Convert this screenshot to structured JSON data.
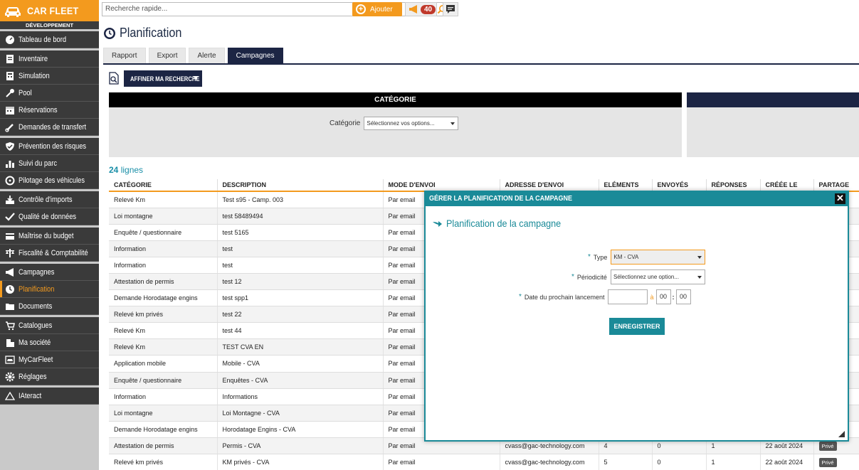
{
  "app": {
    "brand": "CAR FLEET",
    "environment": "DÉVELOPPEMENT"
  },
  "sidebar": {
    "groups": [
      [
        {
          "label": "Tableau de bord",
          "icon": "dashboard-icon"
        }
      ],
      [
        {
          "label": "Inventaire",
          "icon": "inventory-icon"
        },
        {
          "label": "Simulation",
          "icon": "calculator-icon"
        },
        {
          "label": "Pool",
          "icon": "key-icon"
        },
        {
          "label": "Réservations",
          "icon": "calendar-icon"
        },
        {
          "label": "Demandes de transfert",
          "icon": "link-icon"
        }
      ],
      [
        {
          "label": "Prévention des risques",
          "icon": "shield-icon"
        },
        {
          "label": "Suivi du parc",
          "icon": "bar-chart-icon"
        },
        {
          "label": "Pilotage des véhicules",
          "icon": "steering-wheel-icon"
        }
      ],
      [
        {
          "label": "Contrôle d'imports",
          "icon": "import-icon"
        },
        {
          "label": "Qualité de données",
          "icon": "check-icon"
        }
      ],
      [
        {
          "label": "Maîtrise du budget",
          "icon": "budget-icon"
        },
        {
          "label": "Fiscalité & Comptabilité",
          "icon": "balance-icon"
        }
      ],
      [
        {
          "label": "Campagnes",
          "icon": "megaphone-icon"
        },
        {
          "label": "Planification",
          "icon": "clock-icon",
          "active": true
        },
        {
          "label": "Documents",
          "icon": "folder-icon"
        }
      ],
      [
        {
          "label": "Catalogues",
          "icon": "cart-icon"
        },
        {
          "label": "Ma société",
          "icon": "building-icon"
        },
        {
          "label": "MyCarFleet",
          "icon": "car-icon"
        },
        {
          "label": "Réglages",
          "icon": "gear-icon"
        }
      ],
      [
        {
          "label": "IAteract",
          "icon": "ai-icon"
        }
      ]
    ]
  },
  "topbar": {
    "search_placeholder": "Recherche rapide...",
    "add_label": "Ajouter",
    "notif_count": "40"
  },
  "page": {
    "title": "Planification"
  },
  "tabs": [
    {
      "label": "Rapport"
    },
    {
      "label": "Export"
    },
    {
      "label": "Alerte"
    },
    {
      "label": "Campagnes",
      "active": true
    }
  ],
  "filters": {
    "button": "AFFINER MA RECHERCHE",
    "category_header": "CATÉGORIE",
    "category_label": "Catégorie",
    "category_placeholder": "Sélectionnez vos options..."
  },
  "table": {
    "count": "24",
    "count_suffix": " lignes",
    "columns": [
      "CATÉGORIE",
      "DESCRIPTION",
      "MODE D'ENVOI",
      "ADRESSE D'ENVOI",
      "ELÉMENTS",
      "ENVOYÉS",
      "RÉPONSES",
      "CRÉÉE LE",
      "PARTAGE"
    ],
    "rows": [
      [
        "Relevé Km",
        "Test s95 - Camp. 003",
        "Par email",
        "",
        "",
        "",
        "",
        "",
        ""
      ],
      [
        "Loi montagne",
        "test 58489494",
        "Par email",
        "",
        "",
        "",
        "",
        "",
        ""
      ],
      [
        "Enquête / questionnaire",
        "test 5165",
        "Par email",
        "",
        "",
        "",
        "",
        "",
        ""
      ],
      [
        "Information",
        "test",
        "Par email",
        "",
        "",
        "",
        "",
        "",
        ""
      ],
      [
        "Information",
        "test",
        "Par email",
        "",
        "",
        "",
        "",
        "",
        ""
      ],
      [
        "Attestation de permis",
        "test 12",
        "Par email",
        "",
        "",
        "",
        "",
        "",
        ""
      ],
      [
        "Demande Horodatage engins",
        "test spp1",
        "Par email",
        "",
        "",
        "",
        "",
        "",
        ""
      ],
      [
        "Relevé km privés",
        "test 22",
        "Par email",
        "",
        "",
        "",
        "",
        "",
        ""
      ],
      [
        "Relevé Km",
        "test 44",
        "Par email",
        "",
        "",
        "",
        "",
        "",
        ""
      ],
      [
        "Relevé Km",
        "TEST CVA EN",
        "Par email",
        "",
        "",
        "",
        "",
        "",
        ""
      ],
      [
        "Application mobile",
        "Mobile - CVA",
        "Par email",
        "",
        "",
        "",
        "",
        "",
        ""
      ],
      [
        "Enquête / questionnaire",
        "Enquêtes - CVA",
        "Par email",
        "",
        "",
        "",
        "",
        "",
        ""
      ],
      [
        "Information",
        "Informations",
        "Par email",
        "",
        "",
        "",
        "",
        "",
        ""
      ],
      [
        "Loi montagne",
        "Loi Montagne - CVA",
        "Par email",
        "",
        "",
        "",
        "",
        "",
        ""
      ],
      [
        "Demande Horodatage engins",
        "Horodatage Engins - CVA",
        "Par email",
        "",
        "",
        "",
        "",
        "",
        ""
      ],
      [
        "Attestation de permis",
        "Permis - CVA",
        "Par email",
        "cvass@gac-technology.com",
        "4",
        "0",
        "1",
        "22 août 2024",
        "Privé"
      ],
      [
        "Relevé km privés",
        "KM privés - CVA",
        "Par email",
        "cvass@gac-technology.com",
        "5",
        "0",
        "1",
        "22 août 2024",
        "Privé"
      ]
    ]
  },
  "modal": {
    "title": "GÉRER LA PLANIFICATION DE LA CAMPAGNE",
    "subtitle": "Planification de la campagne",
    "type_label": "Type",
    "type_value": "KM - CVA",
    "periodicite_label": "Périodicité",
    "periodicite_placeholder": "Sélectionnez une option...",
    "date_label": "Date du prochain lancement",
    "at": "à",
    "hour": "00",
    "colon": ":",
    "minute": "00",
    "save": "ENREGISTRER",
    "required_mark": "*"
  },
  "colors": {
    "accent": "#f39a1e",
    "navy": "#1c2544",
    "teal": "#1a8a98",
    "sidebar": "#3a3a3a"
  }
}
